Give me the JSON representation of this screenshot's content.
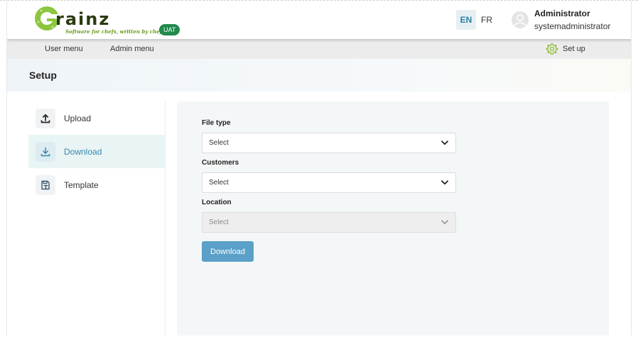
{
  "header": {
    "logo_word": "rainz",
    "logo_tagline": "Software for chefs, written by chefs",
    "env_badge": "UAT",
    "languages": [
      {
        "code": "EN",
        "active": true
      },
      {
        "code": "FR",
        "active": false
      }
    ],
    "user": {
      "name": "Administrator",
      "login": "systemadministrator"
    }
  },
  "nav": {
    "user_menu": "User menu",
    "admin_menu": "Admin menu",
    "setup": "Set up",
    "setup_icon": "gear-icon"
  },
  "page": {
    "title": "Setup"
  },
  "sidebar": {
    "items": [
      {
        "label": "Upload",
        "icon": "upload-icon",
        "active": false
      },
      {
        "label": "Download",
        "icon": "download-icon",
        "active": true
      },
      {
        "label": "Template",
        "icon": "template-icon",
        "active": false
      }
    ]
  },
  "form": {
    "file_type": {
      "label": "File type",
      "value": "Select"
    },
    "customers": {
      "label": "Customers",
      "value": "Select"
    },
    "location": {
      "label": "Location",
      "value": "Select",
      "disabled": true
    },
    "submit_label": "Download"
  },
  "colors": {
    "accent": "#5aa0c8",
    "active_item_bg": "#e9f4f5",
    "badge_green": "#1f8a4c",
    "logo_green": "#8cc63f"
  }
}
